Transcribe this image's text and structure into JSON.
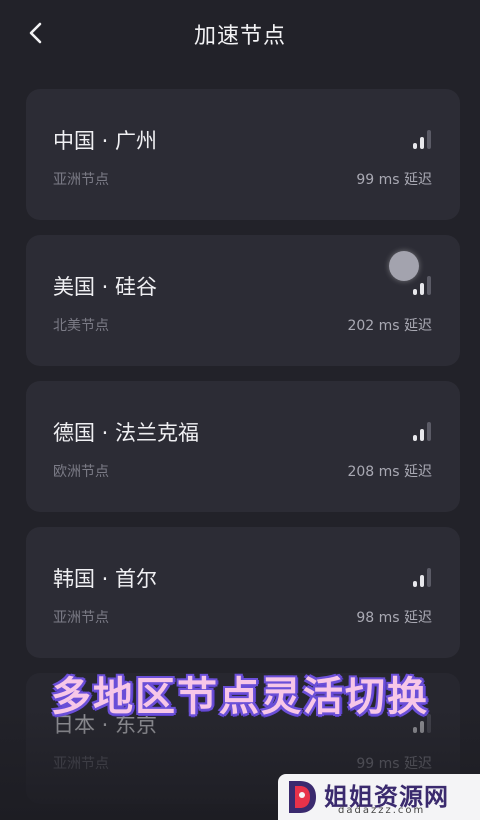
{
  "header": {
    "title": "加速节点",
    "back_icon": "chevron-left-icon"
  },
  "nodes": [
    {
      "name": "中国 · 广州",
      "region": "亚洲节点",
      "latency": "99 ms 延迟",
      "signal_bars": 2,
      "signal_max": 3
    },
    {
      "name": "美国 · 硅谷",
      "region": "北美节点",
      "latency": "202 ms 延迟",
      "signal_bars": 2,
      "signal_max": 3
    },
    {
      "name": "德国 · 法兰克福",
      "region": "欧洲节点",
      "latency": "208 ms 延迟",
      "signal_bars": 2,
      "signal_max": 3
    },
    {
      "name": "韩国 · 首尔",
      "region": "亚洲节点",
      "latency": "98 ms 延迟",
      "signal_bars": 2,
      "signal_max": 3
    },
    {
      "name": "日本 · 东京",
      "region": "亚洲节点",
      "latency": "99 ms 延迟",
      "signal_bars": 2,
      "signal_max": 3
    }
  ],
  "overlay": {
    "caption": "多地区节点灵活切换"
  },
  "watermark": {
    "name": "姐姐资源网",
    "domain": "dadazzz.com"
  },
  "colors": {
    "background": "#222229",
    "card": "#2c2c35",
    "caption_fill": "#f7c7e8",
    "caption_outline": "#6b4fd8"
  }
}
